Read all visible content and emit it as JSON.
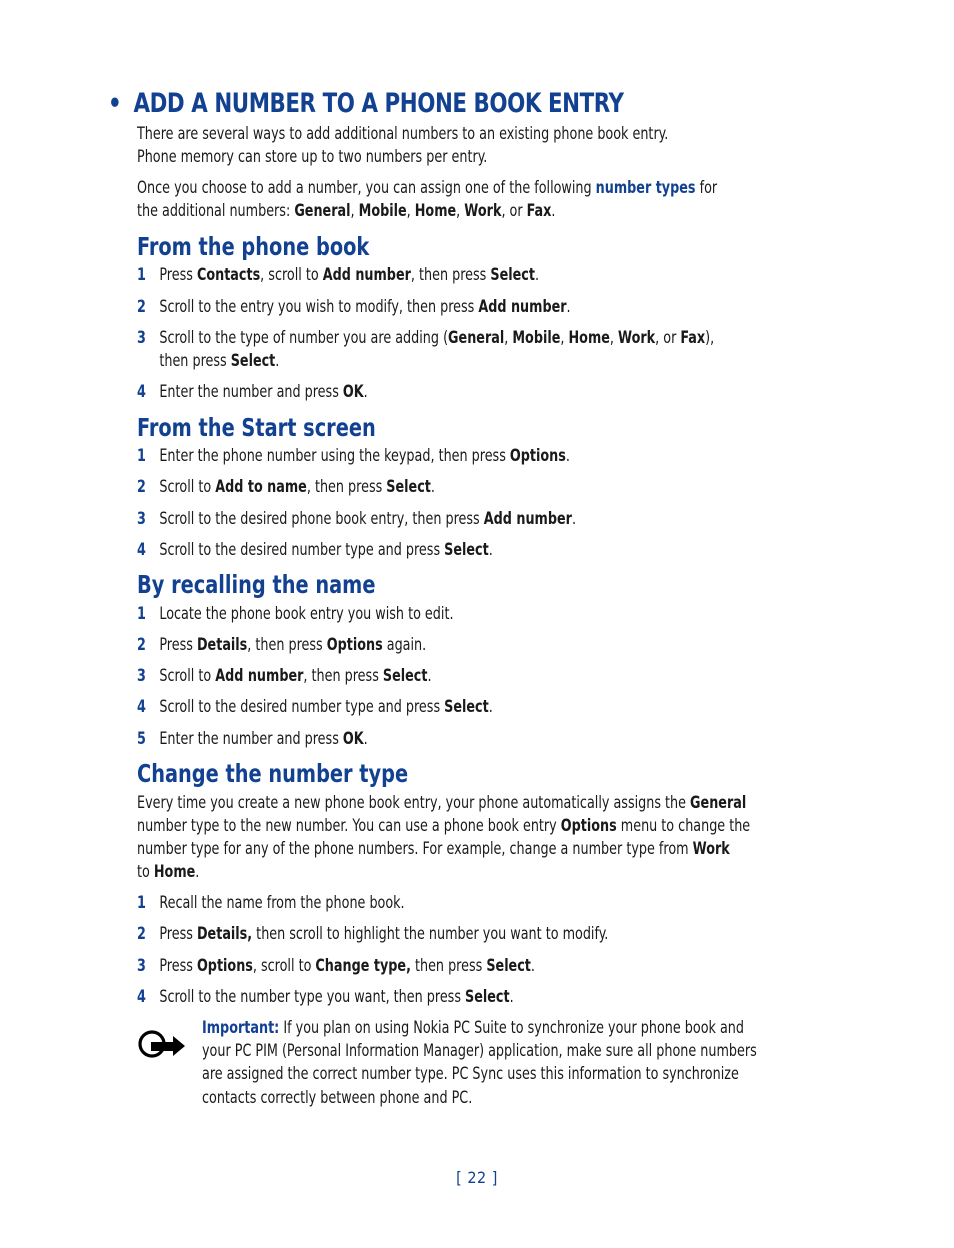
{
  "title": {
    "bullet": "•",
    "text": "ADD A NUMBER TO A PHONE BOOK ENTRY"
  },
  "intro": {
    "line1": "There are several ways to add additional numbers to an existing phone book entry.",
    "line2": "Phone memory can store up to two numbers per entry.",
    "p2_a": "Once you choose to add a number, you can assign one of the following ",
    "p2_link": "number types",
    "p2_b": " for",
    "p2_c": "the additional numbers: ",
    "types": [
      "General",
      "Mobile",
      "Home",
      "Work",
      "Fax"
    ],
    "sep": ", ",
    "or": ", or ",
    "end": "."
  },
  "sections": {
    "phonebook": {
      "heading": "From the phone book",
      "steps": [
        {
          "n": "1",
          "parts": [
            "Press ",
            "Contacts",
            ", scroll to ",
            "Add number",
            ", then press ",
            "Select",
            "."
          ]
        },
        {
          "n": "2",
          "parts": [
            "Scroll to the entry you wish to modify, then press ",
            "Add number",
            "."
          ]
        },
        {
          "n": "3",
          "line1": [
            "Scroll to the type of number you are adding (",
            "General",
            ", ",
            "Mobile",
            ", ",
            "Home",
            ", ",
            "Work",
            ", or ",
            "Fax",
            "),"
          ],
          "line2": [
            "then press ",
            "Select",
            "."
          ]
        },
        {
          "n": "4",
          "parts": [
            "Enter the number and press ",
            "OK",
            "."
          ]
        }
      ]
    },
    "start": {
      "heading": "From the Start screen",
      "steps": [
        {
          "n": "1",
          "parts": [
            "Enter the phone number using the keypad, then press ",
            "Options",
            "."
          ]
        },
        {
          "n": "2",
          "parts": [
            "Scroll to ",
            "Add to name",
            ", then press ",
            "Select",
            "."
          ]
        },
        {
          "n": "3",
          "parts": [
            "Scroll to the desired phone book entry, then press ",
            "Add number",
            "."
          ]
        },
        {
          "n": "4",
          "parts": [
            "Scroll to the desired number type and press ",
            "Select",
            "."
          ]
        }
      ]
    },
    "recall": {
      "heading": "By recalling the name",
      "steps": [
        {
          "n": "1",
          "parts": [
            "Locate the phone book entry you wish to edit."
          ]
        },
        {
          "n": "2",
          "parts": [
            "Press ",
            "Details",
            ", then press ",
            "Options",
            " again."
          ]
        },
        {
          "n": "3",
          "parts": [
            "Scroll to ",
            "Add number",
            ", then press ",
            "Select",
            "."
          ]
        },
        {
          "n": "4",
          "parts": [
            "Scroll to the desired number type and press ",
            "Select",
            "."
          ]
        },
        {
          "n": "5",
          "parts": [
            "Enter the number and press ",
            "OK",
            "."
          ]
        }
      ]
    },
    "change": {
      "heading": "Change the number type",
      "para": {
        "l1": [
          "Every time you create a new phone book entry, your phone automatically assigns the ",
          "General"
        ],
        "l2": [
          "number type to the new number. You can use a phone book entry ",
          "Options",
          " menu to change the"
        ],
        "l3": [
          "number type for any of the phone numbers. For example, change a number type from ",
          "Work"
        ],
        "l4": [
          "to ",
          "Home",
          "."
        ]
      },
      "steps": [
        {
          "n": "1",
          "parts": [
            "Recall the name from the phone book."
          ]
        },
        {
          "n": "2",
          "parts": [
            "Press ",
            "Details,",
            " then scroll to highlight the number you want to modify."
          ]
        },
        {
          "n": "3",
          "parts": [
            "Press ",
            "Options",
            ", scroll to ",
            "Change type,",
            " then press ",
            "Select",
            "."
          ]
        },
        {
          "n": "4",
          "parts": [
            "Scroll to the number type you want, then press ",
            "Select",
            "."
          ]
        }
      ]
    }
  },
  "note": {
    "icon": "important-arrow-icon",
    "label": "Important:",
    "l1": " If you plan on using Nokia PC Suite to synchronize your phone book and",
    "l2": "your PC PIM (Personal Information Manager) application, make sure all phone numbers",
    "l3": "are assigned the correct number type. PC Sync uses this information to synchronize",
    "l4": "contacts correctly between phone and PC."
  },
  "footer": {
    "page": "[ 22 ]"
  },
  "colors": {
    "accent": "#124191",
    "text": "#1a1a1a"
  }
}
